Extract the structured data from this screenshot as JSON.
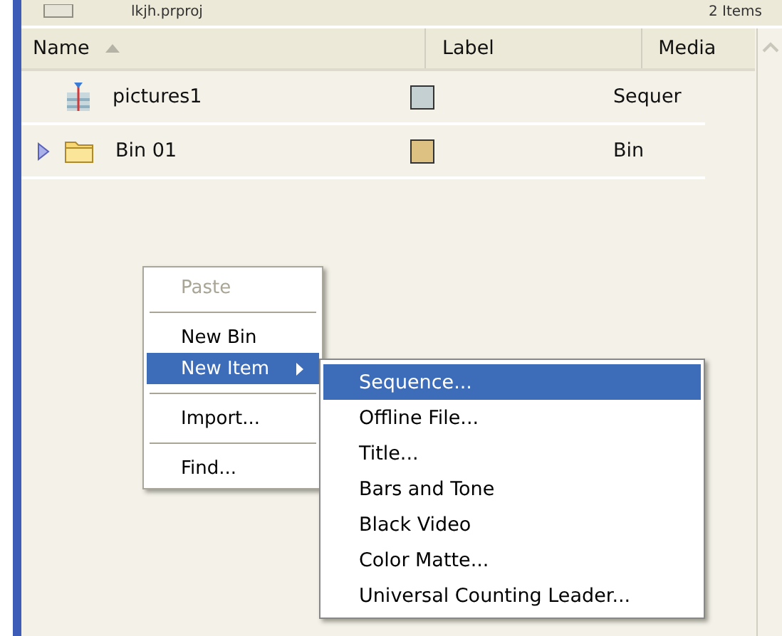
{
  "project": {
    "name": "lkjh.prproj",
    "count": "2 Items"
  },
  "table": {
    "columns": [
      {
        "label": "Name",
        "sorted": true
      },
      {
        "label": "Label",
        "sorted": false
      },
      {
        "label": "Media",
        "sorted": false
      }
    ],
    "rows": [
      {
        "kind": "sequence",
        "name": "pictures1",
        "color": "#c5d0d3",
        "media": "Sequer"
      },
      {
        "kind": "bin",
        "name": "Bin 01",
        "color": "#dcc183",
        "media": "Bin"
      }
    ]
  },
  "context_menu": {
    "items": [
      {
        "kind": "item",
        "label": "Paste",
        "disabled": true,
        "selected": false,
        "submenu": false
      },
      {
        "kind": "separator"
      },
      {
        "kind": "item",
        "label": "New Bin",
        "disabled": false,
        "selected": false,
        "submenu": false
      },
      {
        "kind": "item",
        "label": "New Item",
        "disabled": false,
        "selected": true,
        "submenu": true
      },
      {
        "kind": "separator"
      },
      {
        "kind": "item",
        "label": "Import...",
        "disabled": false,
        "selected": false,
        "submenu": false
      },
      {
        "kind": "separator"
      },
      {
        "kind": "item",
        "label": "Find...",
        "disabled": false,
        "selected": false,
        "submenu": false
      }
    ]
  },
  "submenu": {
    "items": [
      {
        "label": "Sequence...",
        "selected": true
      },
      {
        "label": "Offline File...",
        "selected": false
      },
      {
        "label": "Title...",
        "selected": false
      },
      {
        "label": "Bars and Tone",
        "selected": false
      },
      {
        "label": "Black Video",
        "selected": false
      },
      {
        "label": "Color Matte...",
        "selected": false
      },
      {
        "label": "Universal Counting Leader...",
        "selected": false
      }
    ]
  }
}
